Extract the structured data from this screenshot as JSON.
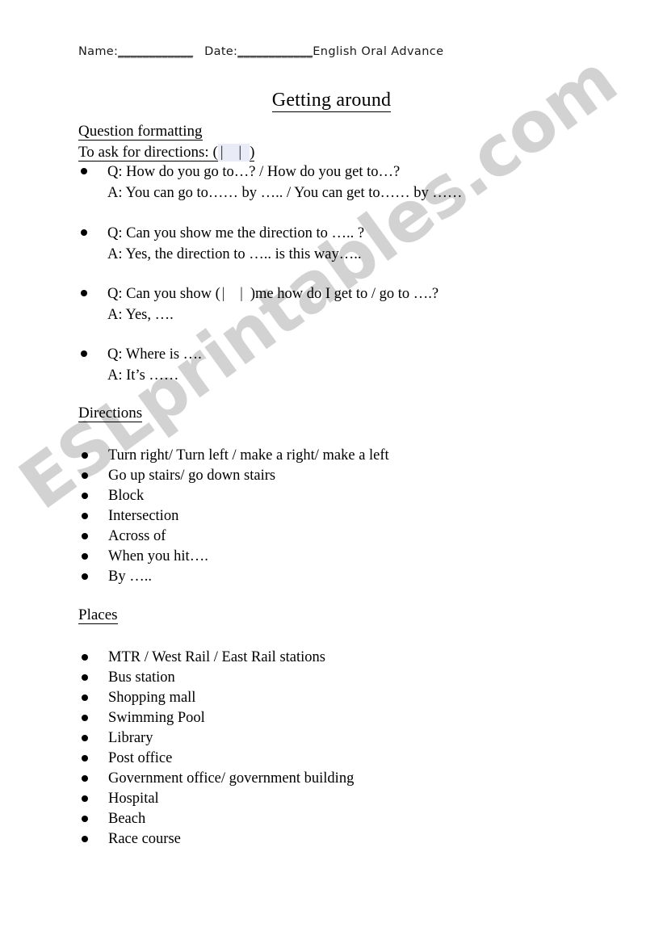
{
  "header": {
    "name_label": "Name:",
    "name_blank": "____________",
    "date_label": "Date:",
    "date_blank": "____________",
    "course": "English Oral Advance"
  },
  "title": "Getting around",
  "sections": {
    "question_formatting": {
      "heading": "Question formatting",
      "subheading_prefix": "To ask for directions: (",
      "subheading_glyphs": "| |",
      "subheading_suffix": ")",
      "qa": [
        {
          "question": "Q: How do you go to…? / How do you get to…?",
          "answer": "A: You can go to…… by ….. / You can get to…… by ……"
        },
        {
          "question": "Q: Can you show me the direction to ….. ?",
          "answer": "A: Yes, the direction to ….. is this way….."
        },
        {
          "question_before": "Q: Can you show (",
          "question_glyphs": "| |",
          "question_after": ")me how do I get to / go to ….?",
          "answer": "A: Yes, …."
        },
        {
          "question": "Q: Where is ….",
          "answer": "A: It’s ……"
        }
      ]
    },
    "directions": {
      "heading": "Directions",
      "items": [
        "Turn right/ Turn left / make a right/ make a left",
        "Go up stairs/ go down stairs",
        "Block",
        "Intersection",
        "Across of",
        "When you hit….",
        "By ….."
      ]
    },
    "places": {
      "heading": "Places",
      "items": [
        "MTR / West Rail / East Rail stations",
        "Bus station",
        "Shopping mall",
        "Swimming Pool",
        "Library",
        "Post office",
        "Government office/ government building",
        "Hospital",
        "Beach",
        "Race course"
      ]
    }
  },
  "watermark": {
    "text": "ESLprintables.com",
    "color": "#d2d2d2"
  },
  "colors": {
    "text": "#000000",
    "highlight": "#e9ebf6",
    "watermark": "#d2d2d2"
  }
}
